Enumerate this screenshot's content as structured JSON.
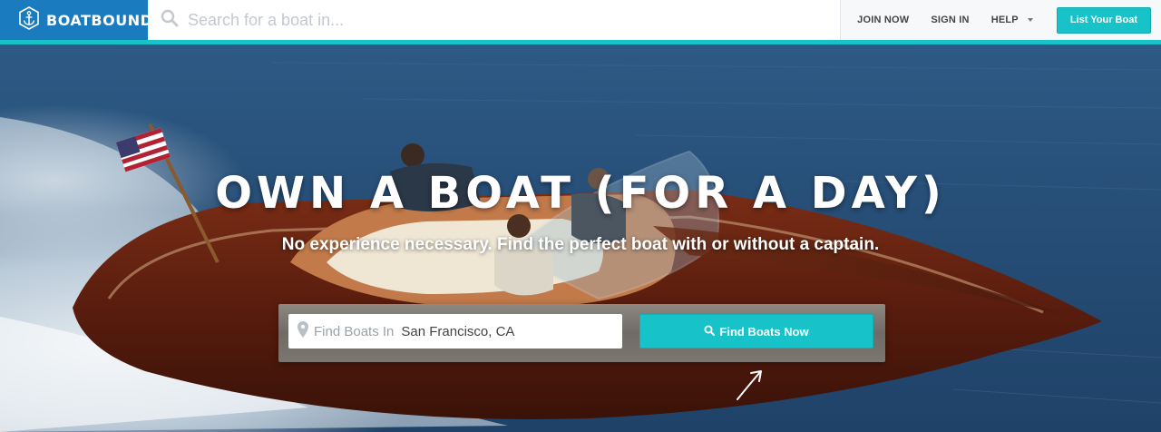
{
  "header": {
    "logo_text": "BOATBOUND",
    "search_placeholder": "Search for a boat in...",
    "nav": {
      "join": "JOIN NOW",
      "signin": "SIGN IN",
      "help": "HELP"
    },
    "list_button": "List Your Boat"
  },
  "hero": {
    "headline": "OWN A BOAT (FOR A DAY)",
    "subline": "No experience necessary. Find the perfect boat with or without a captain.",
    "search": {
      "prefix": "Find Boats In",
      "value": "San Francisco, CA",
      "button": "Find Boats Now"
    }
  },
  "colors": {
    "brand_blue": "#1a7bbf",
    "accent_teal": "#17c3c9",
    "water": "#274f78"
  },
  "icons": [
    "anchor-icon",
    "search-icon",
    "caret-down-icon",
    "map-pin-icon",
    "search-icon",
    "arrow-icon"
  ]
}
